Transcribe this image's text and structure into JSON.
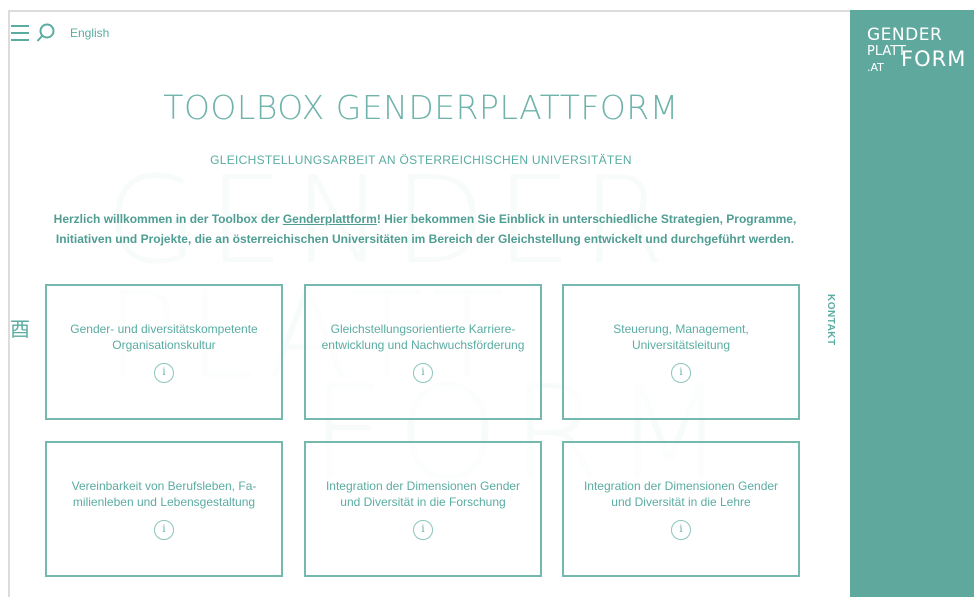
{
  "header": {
    "language": "English"
  },
  "sidebar": {
    "logo_line1": "GENDER",
    "logo_line2": "PLATT",
    "logo_line3": ".AT",
    "logo_line4": "FORM"
  },
  "main": {
    "title": "TOOLBOX GENDERPLATTFORM",
    "subtitle": "GLEICHSTELLUNGSARBEIT AN ÖSTERREICHISCHEN UNIVERSITÄTEN",
    "intro_before": "Herzlich willkommen in der Toolbox der ",
    "intro_link": "Genderplattform",
    "intro_after": "! Hier bekommen Sie Einblick in unterschiedliche Strategien, Programme, Initiativen und Projekte, die an österreichischen Universitäten im Bereich der Gleichstellung entwickelt und durchgeführt werden.",
    "kontakt": "KONTAKT",
    "side_icon": "酉",
    "cards": [
      {
        "title": "Gender- und diversitätskompetente Organisationskultur",
        "info": "i"
      },
      {
        "title": "Gleichstellungsorientierte Karriere-entwicklung und Nachwuchsförderung",
        "info": "i"
      },
      {
        "title": "Steuerung, Management, Universitätsleitung",
        "info": "i"
      },
      {
        "title": "Vereinbarkeit von Berufsleben, Fa-milienleben und Lebensgestaltung",
        "info": "i"
      },
      {
        "title": "Integration der Dimensionen Gender und Diversität in die Forschung",
        "info": "i"
      },
      {
        "title": "Integration der Dimensionen Gender und Diversität in die Lehre",
        "info": "i"
      }
    ]
  },
  "colors": {
    "accent": "#5aaca2",
    "sidebar_bg": "#5fa89e"
  },
  "icons": [
    "menu-icon",
    "search-icon",
    "info-icon",
    "side-tool-icon"
  ]
}
